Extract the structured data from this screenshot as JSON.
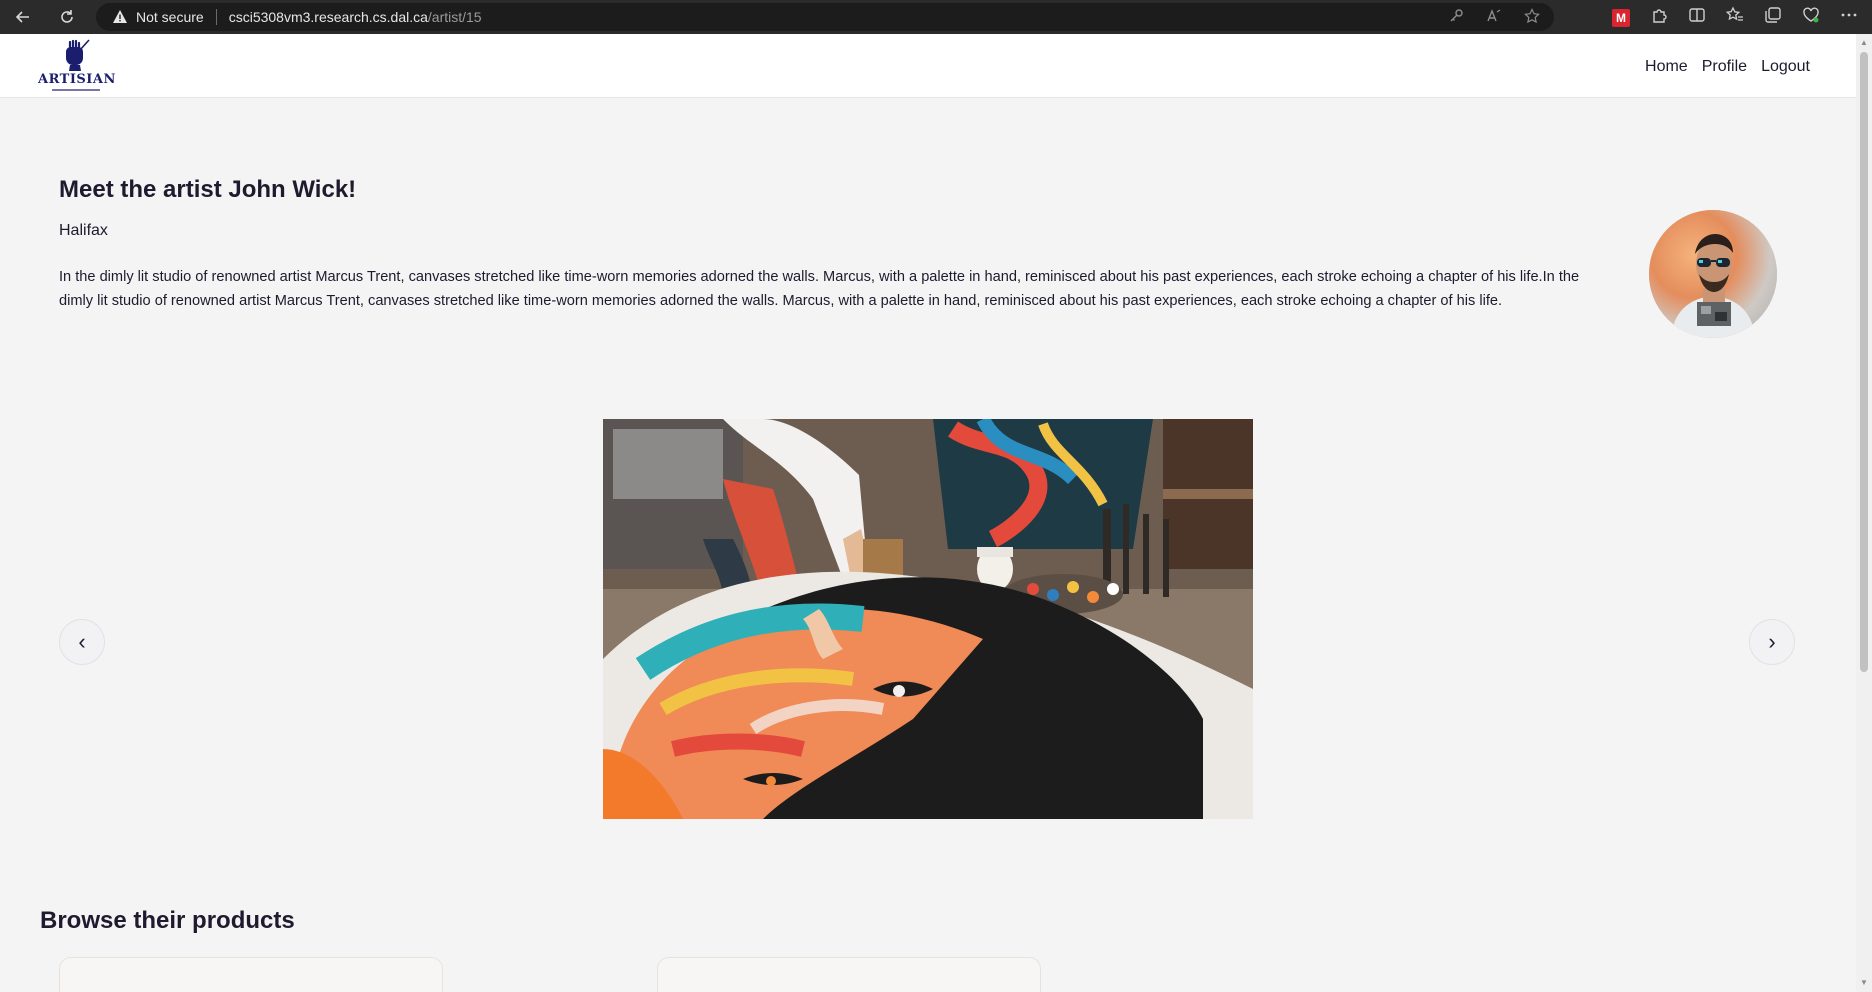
{
  "browser": {
    "security_label": "Not secure",
    "url_host": "csci5308vm3.research.cs.dal.ca",
    "url_path": "/artist/15",
    "back_icon": "back-arrow-icon",
    "refresh_icon": "refresh-icon",
    "warning_icon": "warning-triangle-icon",
    "extension_label": "M"
  },
  "site": {
    "brand": "ARTISIAN",
    "nav": {
      "home": "Home",
      "profile": "Profile",
      "logout": "Logout"
    }
  },
  "artist": {
    "title": "Meet the artist John Wick!",
    "city": "Halifax",
    "bio": "In the dimly lit studio of renowned artist Marcus Trent, canvases stretched like time-worn memories adorned the walls. Marcus, with a palette in hand, reminisced about his past experiences, each stroke echoing a chapter of his life.In the dimly lit studio of renowned artist Marcus Trent, canvases stretched like time-worn memories adorned the walls. Marcus, with a palette in hand, reminisced about his past experiences, each stroke echoing a chapter of his life."
  },
  "carousel": {
    "prev": "‹",
    "next": "›"
  },
  "products": {
    "heading": "Browse their products"
  },
  "colors": {
    "page_bg": "#f4f4f4",
    "text": "#1f1a2e",
    "brand_navy": "#1b1d6e"
  }
}
